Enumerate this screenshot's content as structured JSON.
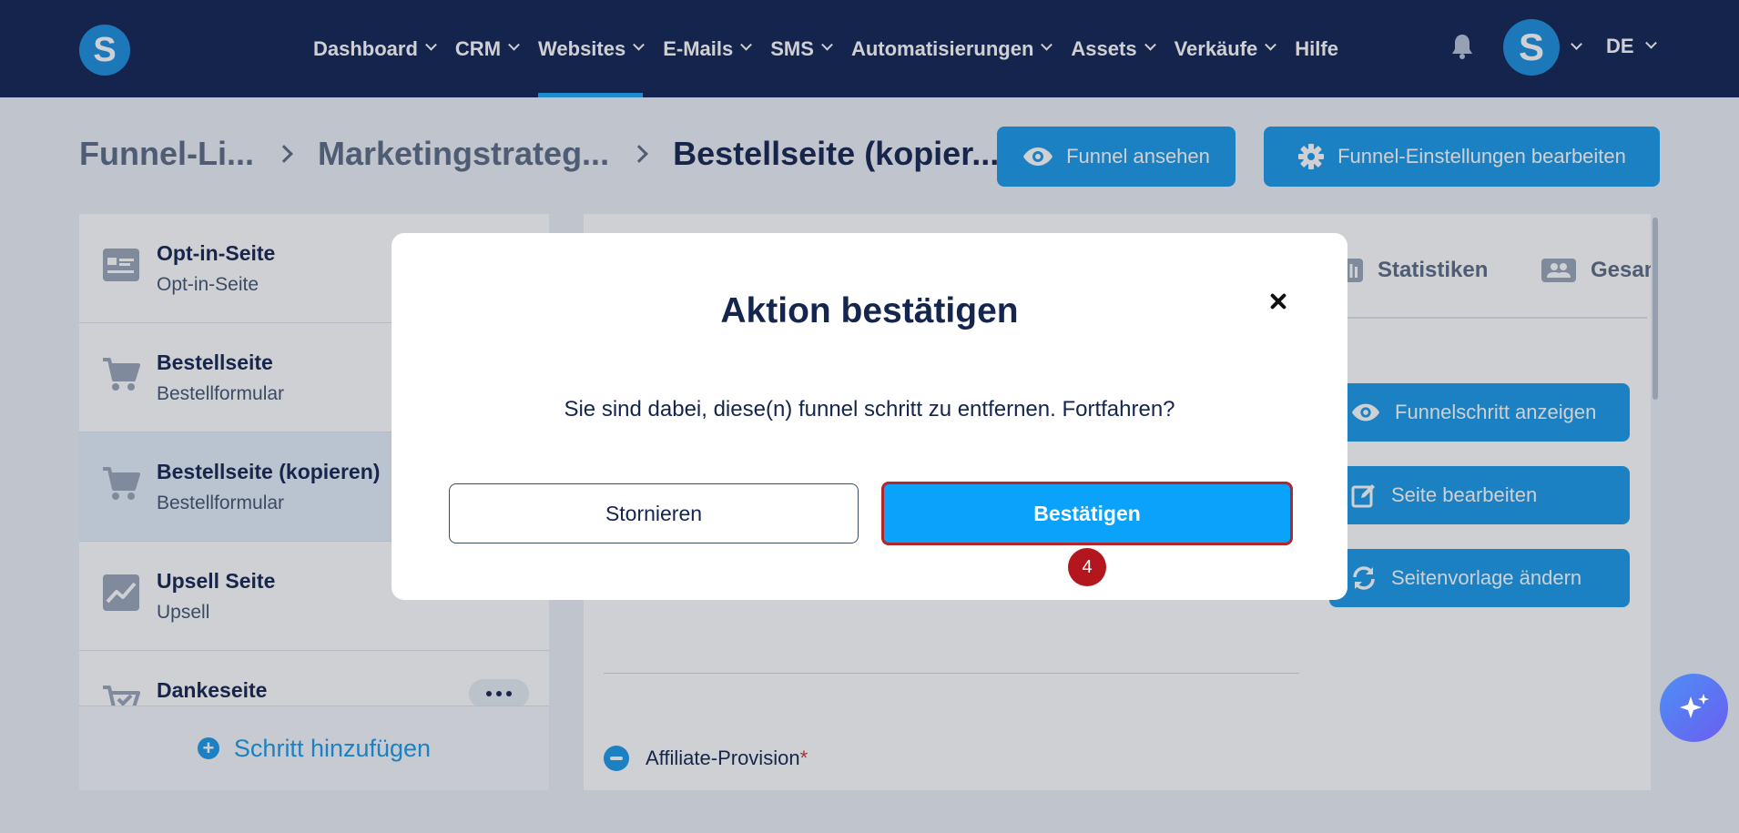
{
  "app": {
    "logo_letter": "S"
  },
  "nav": {
    "items": [
      {
        "label": "Dashboard",
        "has_menu": true
      },
      {
        "label": "CRM",
        "has_menu": true
      },
      {
        "label": "Websites",
        "has_menu": true,
        "active": true
      },
      {
        "label": "E-Mails",
        "has_menu": true
      },
      {
        "label": "SMS",
        "has_menu": true
      },
      {
        "label": "Automatisierungen",
        "has_menu": true
      },
      {
        "label": "Assets",
        "has_menu": true
      },
      {
        "label": "Verkäufe",
        "has_menu": true
      },
      {
        "label": "Hilfe",
        "has_menu": false
      }
    ],
    "avatar_letter": "S",
    "language": "DE"
  },
  "breadcrumb": {
    "items": [
      "Funnel-Li...",
      "Marketingstrateg...",
      "Bestellseite (kopier..."
    ]
  },
  "header_actions": {
    "view_funnel": "Funnel ansehen",
    "edit_settings": "Funnel-Einstellungen bearbeiten"
  },
  "sidebar": {
    "steps": [
      {
        "title": "Opt-in-Seite",
        "subtitle": "Opt-in-Seite",
        "icon": "form-page-icon"
      },
      {
        "title": "Bestellseite",
        "subtitle": "Bestellformular",
        "icon": "cart-icon"
      },
      {
        "title": "Bestellseite (kopieren)",
        "subtitle": "Bestellformular",
        "icon": "cart-icon",
        "selected": true
      },
      {
        "title": "Upsell Seite",
        "subtitle": "Upsell",
        "icon": "chart-up-icon"
      },
      {
        "title": "Dankeseite",
        "subtitle": "",
        "icon": "cart-check-icon"
      }
    ],
    "add_step": "Schritt hinzufügen"
  },
  "panel": {
    "tabs": [
      {
        "label": "Statistiken"
      },
      {
        "label": "Gesan"
      }
    ],
    "actions": {
      "show_step": "Funnelschritt anzeigen",
      "edit_page": "Seite bearbeiten",
      "change_template": "Seitenvorlage ändern"
    },
    "affiliate_label": "Affiliate-Provision",
    "required_mark": "*"
  },
  "modal": {
    "title": "Aktion bestätigen",
    "message": "Sie sind dabei, diese(n) funnel schritt zu entfernen. Fortfahren?",
    "cancel": "Stornieren",
    "confirm": "Bestätigen",
    "step_number": "4"
  },
  "colors": {
    "nav_bg": "#122352",
    "accent": "#1a9ae8",
    "confirm_bg": "#0aa2fb",
    "highlight_border": "#b3262b"
  }
}
